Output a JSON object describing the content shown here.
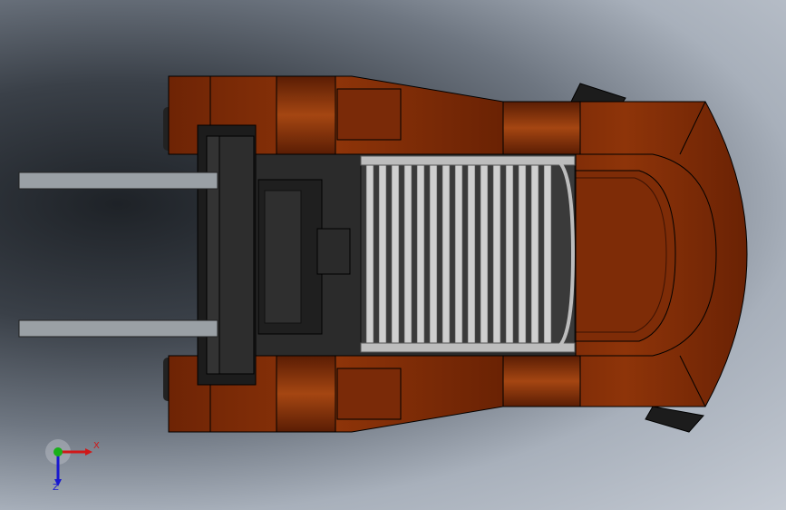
{
  "triad": {
    "x_label": "X",
    "z_label": "Z",
    "colors": {
      "x": "#d01818",
      "y": "#18b018",
      "z": "#1818d0"
    }
  },
  "model": {
    "body_color": "#7a2a08",
    "body_highlight": "#a0420f",
    "fork_color": "#9a9ea3",
    "grille_color": "#c8c8c8",
    "dark_color": "#262626"
  }
}
